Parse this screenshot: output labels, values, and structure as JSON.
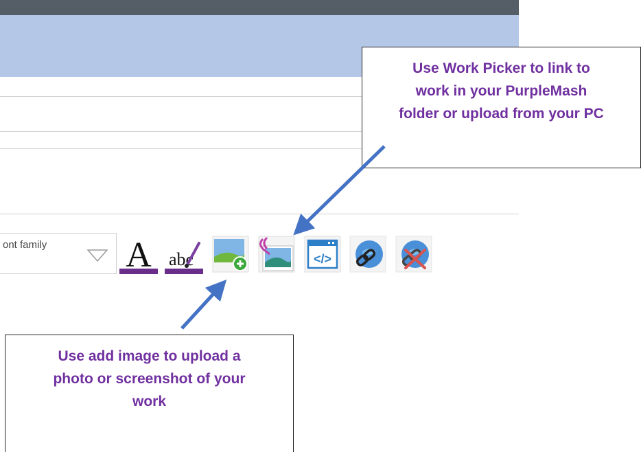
{
  "toolbar": {
    "font_select_label": "ont family",
    "buttons": [
      {
        "icon": "font-size-icon"
      },
      {
        "icon": "spellcheck-icon"
      },
      {
        "icon": "add-image-icon"
      },
      {
        "icon": "work-picker-icon"
      },
      {
        "icon": "html-code-icon"
      },
      {
        "icon": "link-icon"
      },
      {
        "icon": "unlink-icon"
      }
    ]
  },
  "callouts": {
    "work_picker": {
      "lines": [
        "Use Work Picker to link to",
        "work in your PurpleMash",
        "folder or upload from your PC"
      ]
    },
    "add_image": {
      "lines": [
        "Use add image to upload a",
        "photo or screenshot of your",
        "work"
      ]
    }
  },
  "colors": {
    "callout_text": "#7030a0",
    "arrow": "#4472c4",
    "header_band": "#b5c7e6",
    "top_bar": "#555d66"
  }
}
